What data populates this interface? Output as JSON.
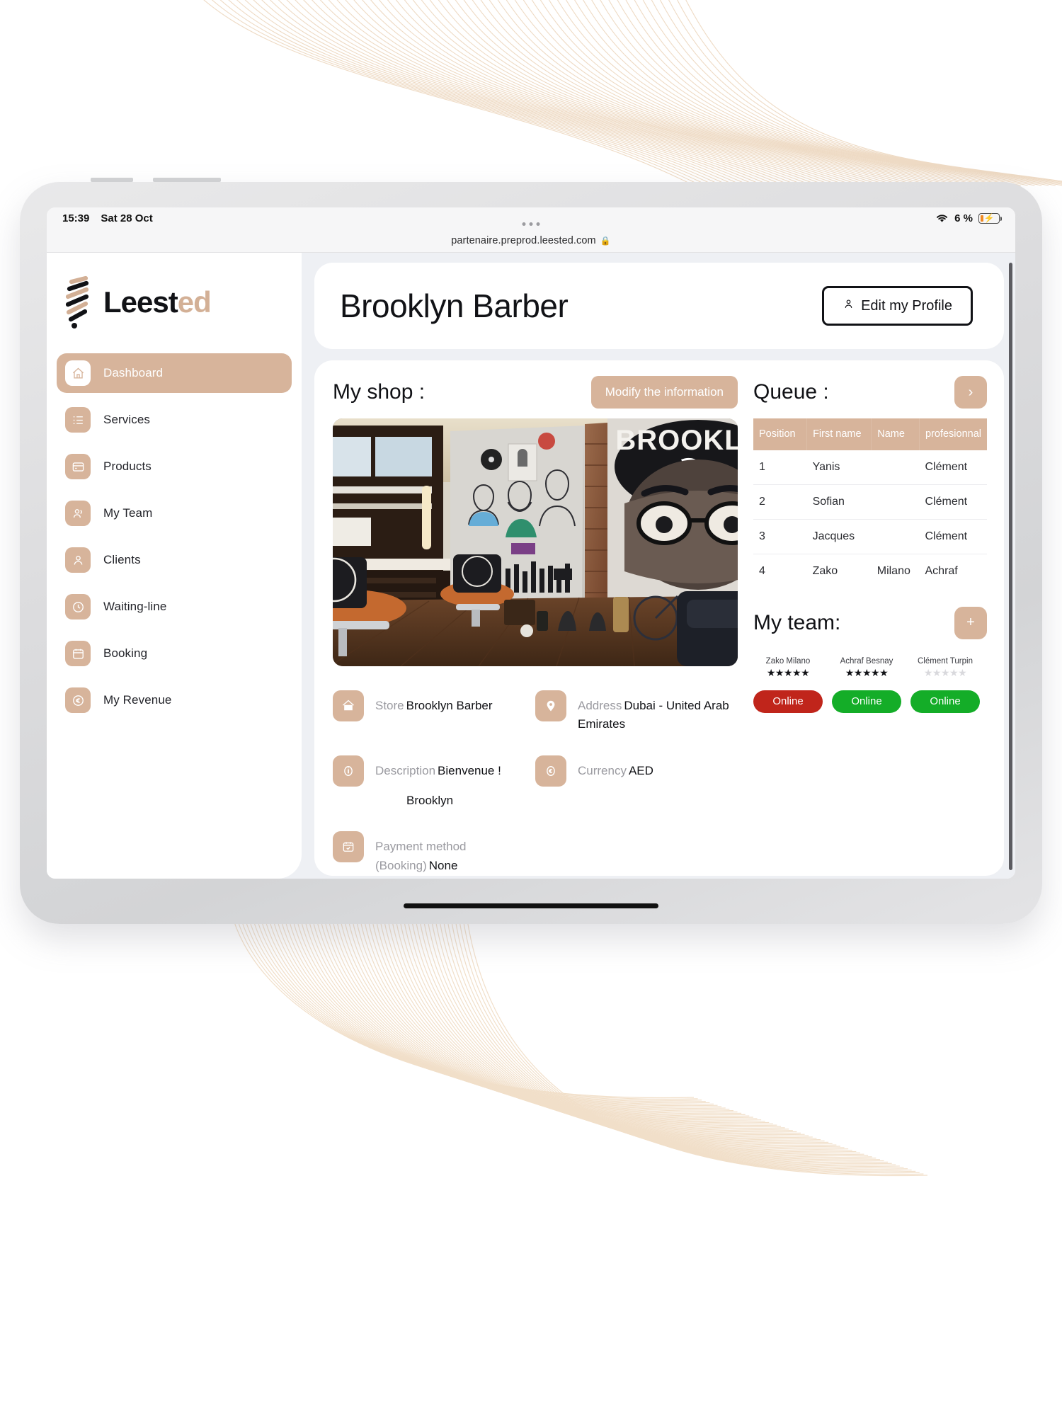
{
  "status_bar": {
    "time": "15:39",
    "date": "Sat 28 Oct",
    "battery_percent": "6 %",
    "wifi_icon": "wifi-icon",
    "battery_icon": "battery-charging-icon"
  },
  "browser": {
    "url": "partenaire.preprod.leested.com",
    "lock_icon": "lock-icon"
  },
  "brand": {
    "name_dark": "Leest",
    "name_accent": "ed",
    "logo_icon": "barber-pole-logo"
  },
  "sidebar": {
    "items": [
      {
        "label": "Dashboard",
        "icon": "home-icon",
        "active": true
      },
      {
        "label": "Services",
        "icon": "list-icon",
        "active": false
      },
      {
        "label": "Products",
        "icon": "wallet-icon",
        "active": false
      },
      {
        "label": "My Team",
        "icon": "users-icon",
        "active": false
      },
      {
        "label": "Clients",
        "icon": "user-icon",
        "active": false
      },
      {
        "label": "Waiting-line",
        "icon": "clock-icon",
        "active": false
      },
      {
        "label": "Booking",
        "icon": "calendar-icon",
        "active": false
      },
      {
        "label": "My Revenue",
        "icon": "euro-icon",
        "active": false
      }
    ]
  },
  "header": {
    "title": "Brooklyn Barber",
    "edit_profile_label": "Edit my Profile",
    "edit_profile_icon": "person-icon"
  },
  "shop": {
    "section_title": "My shop :",
    "modify_button_label": "Modify the information",
    "photo_alt": "barbershop-interior-brooklyn-mural",
    "info": [
      {
        "label": "Store",
        "value": "Brooklyn Barber",
        "icon": "home-icon"
      },
      {
        "label": "Address",
        "value": "Dubai - United Arab Emirates",
        "icon": "map-pin-icon"
      },
      {
        "label": "Description",
        "value": "Bienvenue !",
        "extra": "Brooklyn",
        "icon": "info-icon"
      },
      {
        "label": "Currency",
        "value": "AED",
        "icon": "coin-icon"
      },
      {
        "label": "Payment method (Booking)",
        "value": "None",
        "icon": "calendar-check-icon"
      }
    ]
  },
  "queue": {
    "section_title": "Queue :",
    "next_button_label": "›",
    "next_button_icon": "chevron-right-icon",
    "columns": [
      "Position",
      "First name",
      "Name",
      "profesionnal"
    ],
    "rows": [
      {
        "position": "1",
        "first_name": "Yanis",
        "name": "",
        "professional": "Clément"
      },
      {
        "position": "2",
        "first_name": "Sofian",
        "name": "",
        "professional": "Clément"
      },
      {
        "position": "3",
        "first_name": "Jacques",
        "name": "",
        "professional": "Clément"
      },
      {
        "position": "4",
        "first_name": "Zako",
        "name": "Milano",
        "professional": "Achraf"
      }
    ]
  },
  "team": {
    "section_title": "My team:",
    "add_button_label": "+",
    "add_button_icon": "plus-icon",
    "members": [
      {
        "name": "Zako Milano",
        "rating": 5,
        "status": "Online",
        "status_color": "#c0251b",
        "avatar": "pyramid-photo"
      },
      {
        "name": "Achraf Besnay",
        "rating": 5,
        "status": "Online",
        "status_color": "#14ad28",
        "avatar": "bw-portrait-photo"
      },
      {
        "name": "Clément Turpin",
        "rating": 0,
        "status": "Online",
        "status_color": "#14ad28",
        "avatar": "young-man-photo"
      }
    ]
  },
  "theme": {
    "accent": "#d7b49b",
    "page_bg": "#eef0f4",
    "text_dark": "#111216",
    "muted": "#9a9aa0"
  }
}
